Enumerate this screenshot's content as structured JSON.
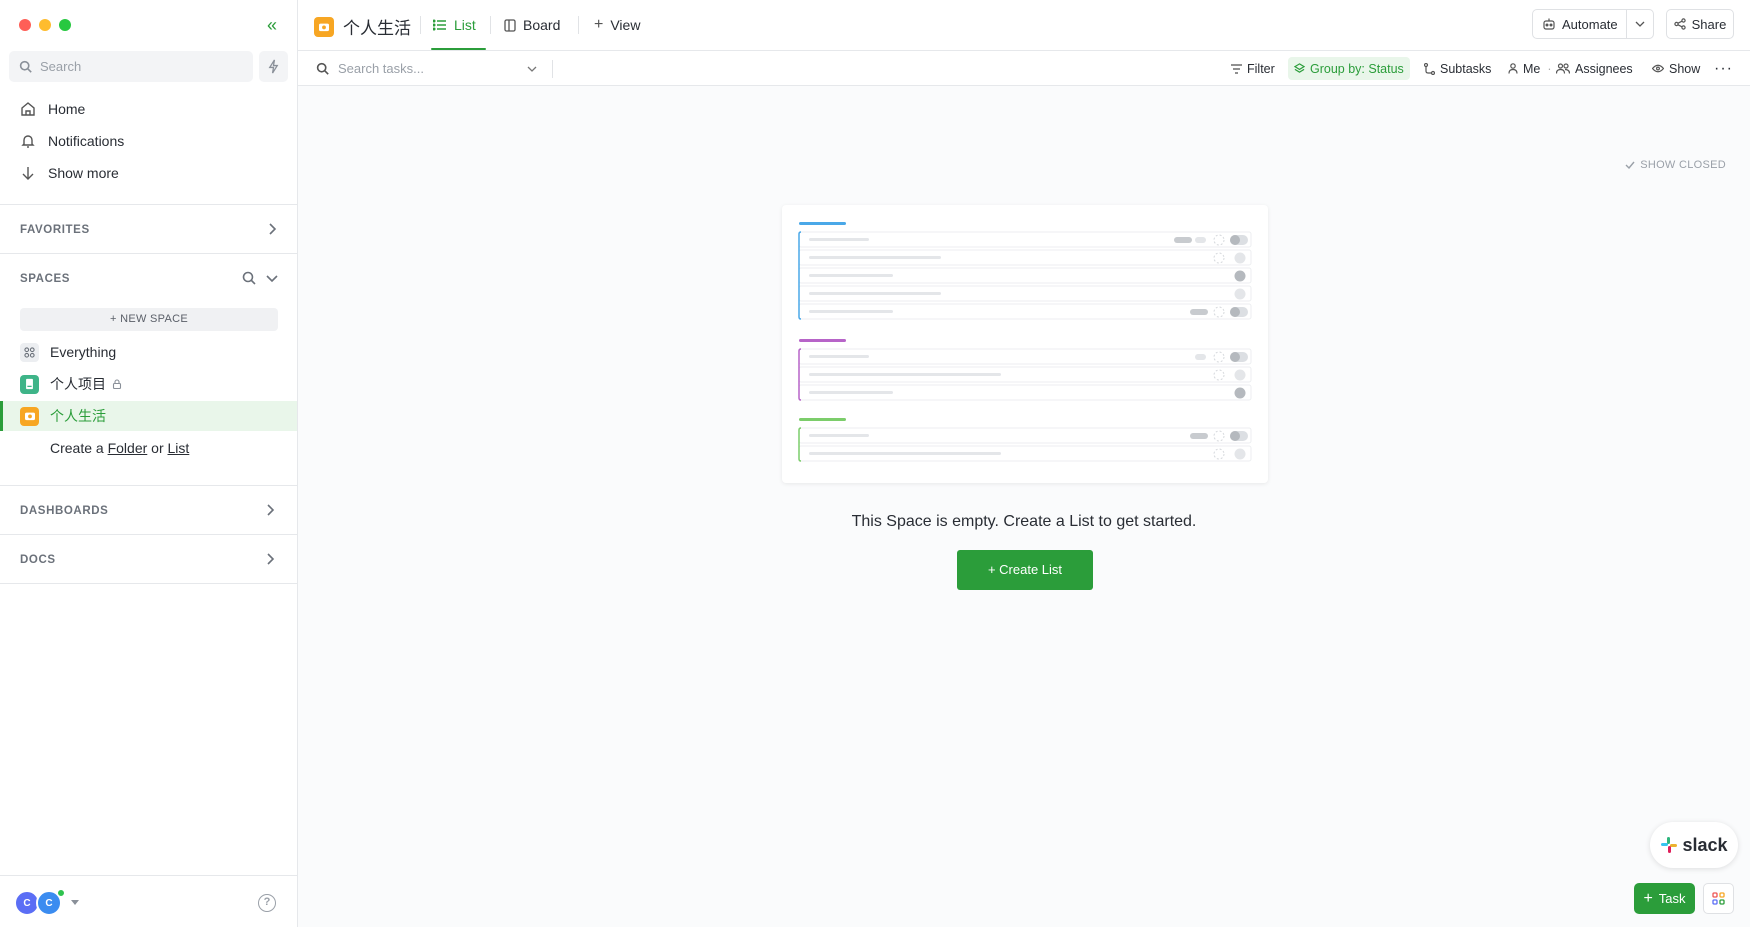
{
  "sidebar": {
    "search_placeholder": "Search",
    "nav": [
      {
        "label": "Home"
      },
      {
        "label": "Notifications"
      },
      {
        "label": "Show more"
      }
    ],
    "favorites_label": "FAVORITES",
    "spaces_label": "SPACES",
    "new_space_label": "+ NEW SPACE",
    "spaces": [
      {
        "label": "Everything"
      },
      {
        "label": "个人项目"
      },
      {
        "label": "个人生活"
      }
    ],
    "create_prefix": "Create a",
    "create_folder": "Folder",
    "create_or": "or",
    "create_list": "List",
    "dashboards_label": "DASHBOARDS",
    "docs_label": "DOCS",
    "avatars": [
      "C",
      "C"
    ],
    "help": "?"
  },
  "topbar": {
    "space_title": "个人生活",
    "tabs": [
      {
        "label": "List"
      },
      {
        "label": "Board"
      },
      {
        "label": "View"
      }
    ],
    "automate_label": "Automate",
    "share_label": "Share"
  },
  "toolbar": {
    "search_placeholder": "Search tasks...",
    "filter": "Filter",
    "group_by": "Group by: Status",
    "subtasks": "Subtasks",
    "me": "Me",
    "assignees": "Assignees",
    "show": "Show"
  },
  "main": {
    "show_closed": "SHOW CLOSED",
    "empty_message": "This Space is empty. Create a List to get started.",
    "create_list_label": "+ Create List"
  },
  "floating": {
    "slack_label": "slack",
    "task_label": "Task"
  },
  "colors": {
    "accent": "#2b9d3a",
    "space_orange": "#f7a623",
    "space_teal": "#3eb488"
  }
}
